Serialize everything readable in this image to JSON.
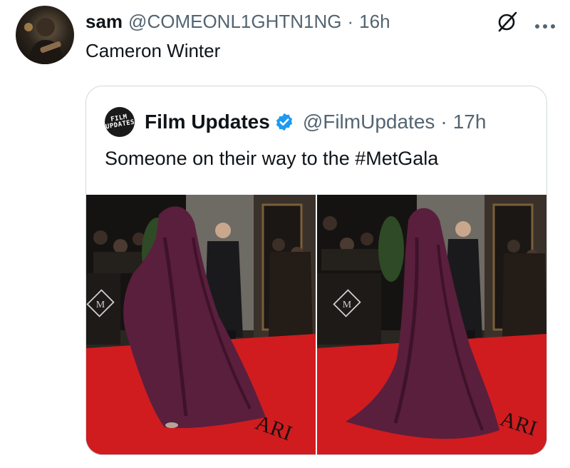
{
  "tweet": {
    "author_name": "sam",
    "author_handle": "@COMEONL1GHTN1NG",
    "separator": "·",
    "time": "16h",
    "text": "Cameron Winter"
  },
  "quoted_tweet": {
    "logo_text": "FILM UPDATES",
    "author_name": "Film Updates",
    "author_handle": "@FilmUpdates",
    "separator": "·",
    "time": "17h",
    "text": "Someone on their way to the #MetGala",
    "images": [
      {
        "sign_letter": "M",
        "carpet_text": "ARI"
      },
      {
        "sign_letter": "M",
        "carpet_text": "ARI"
      }
    ]
  },
  "colors": {
    "text_primary": "#0f1419",
    "text_secondary": "#536471",
    "verified_blue": "#1d9bf0",
    "border": "#cfd9de",
    "carpet_red": "#d01c1f",
    "cloak_purple": "#5a1f3d"
  },
  "icons": [
    "grok-icon",
    "more-icon",
    "verified-icon"
  ]
}
